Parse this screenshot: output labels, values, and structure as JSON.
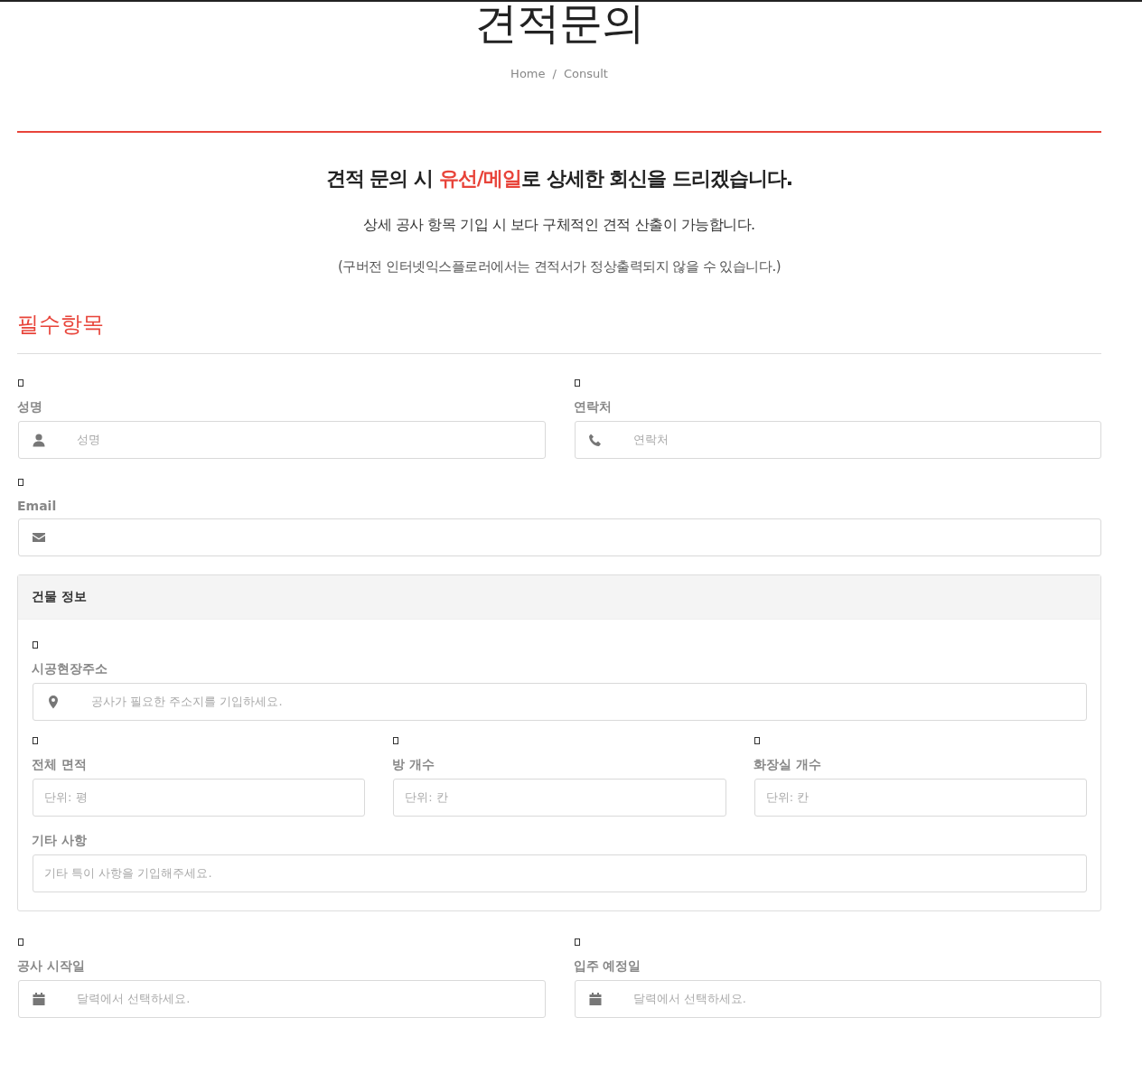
{
  "header": {
    "title": "견적문의",
    "breadcrumb": [
      "Home",
      "Consult"
    ],
    "separator": "/"
  },
  "intro": {
    "headline": [
      {
        "text": "견적 문의 시 ",
        "highlight": false
      },
      {
        "text": "유선/메일",
        "highlight": true
      },
      {
        "text": "로 상세한 회신을 드리겠습니다.",
        "highlight": false
      }
    ],
    "lines": [
      "상세 공사 항목 기입 시 보다 구체적인 견적 산출이 가능합니다.",
      "(구버전 인터넷익스플로러에서는 견적서가 정상출력되지 않을 수 있습니다.)"
    ]
  },
  "section_title": "필수항목",
  "rows": [
    {
      "fields": [
        {
          "label": "성명",
          "marker": true,
          "kind": "person",
          "placeholder": "성명"
        },
        {
          "label": "연락처",
          "marker": true,
          "kind": "phone",
          "placeholder": "연락처"
        }
      ]
    },
    {
      "fields": [
        {
          "label": "Email",
          "marker": true,
          "kind": "envelope"
        }
      ]
    }
  ],
  "panel": {
    "title": "건물 정보",
    "rows": [
      {
        "fields": [
          {
            "label": "시공현장주소",
            "marker": true,
            "kind": "address",
            "placeholder": "공사가 필요한 주소지를 기입하세요."
          }
        ]
      },
      {
        "fields": [
          {
            "label": "전체 면적",
            "marker": true,
            "kind": "plain",
            "placeholder": "단위: 평"
          },
          {
            "label": "방 개수",
            "marker": true,
            "kind": "plain",
            "placeholder": "단위: 칸"
          },
          {
            "label": "화장실 개수",
            "marker": true,
            "kind": "plain",
            "placeholder": "단위: 칸"
          }
        ]
      },
      {
        "fields": [
          {
            "label": "기타 사항",
            "marker": false,
            "kind": "plain",
            "placeholder": "기타 특이 사항을 기입해주세요."
          }
        ]
      }
    ]
  },
  "date_rows": [
    {
      "fields": [
        {
          "label": "공사 시작일",
          "marker": true,
          "kind": "date",
          "placeholder": "달력에서 선택하세요."
        },
        {
          "label": "입주 예정일",
          "marker": true,
          "kind": "date",
          "placeholder": "달력에서 선택하세요."
        }
      ]
    }
  ]
}
